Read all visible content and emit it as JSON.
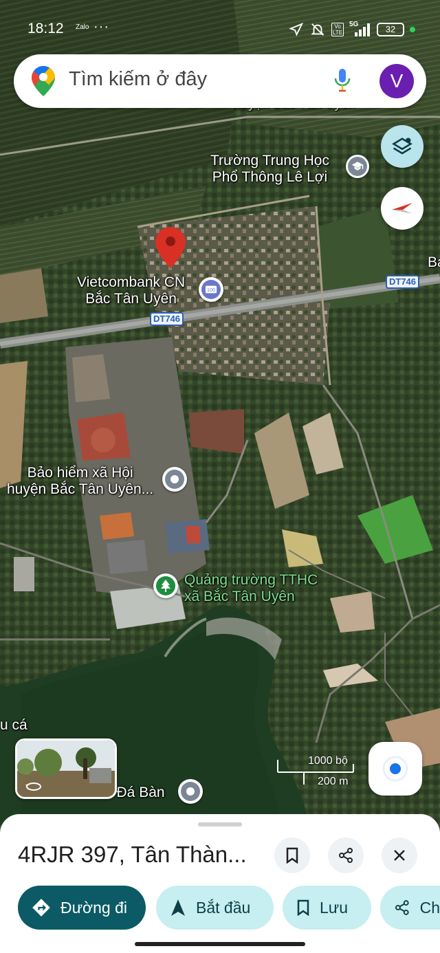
{
  "status_bar": {
    "time": "18:12",
    "notification_app": "Zalo",
    "more": "···",
    "network": "5G",
    "volte": "Vo LTE",
    "battery": "32"
  },
  "search": {
    "placeholder": "Tìm kiếm ở đây",
    "avatar_letter": "V"
  },
  "map": {
    "labels": {
      "school_line1": "Trường Trung Học",
      "school_line2": "Phổ Thông Lê Lợi",
      "bank_line1": "Vietcombank CN",
      "bank_line2": "Bắc Tân Uyên",
      "road_shield_1": "DT746",
      "road_shield_2": "DT746",
      "insurance_line1": "Bảo hiểm xã Hội",
      "insurance_line2": "huyện Bắc Tân Uyên...",
      "square_line1": "Quảng trường TTHC",
      "square_line2": "xã Bắc Tân Uyên",
      "lake_partial": "ồ Đá Bàn",
      "left_edge_partial": "u cá",
      "right_edge_partial": "Ba",
      "top_partial": "huyện Bắc Tân Uyên"
    },
    "scale": {
      "imperial": "1000 bộ",
      "metric": "200 m"
    },
    "colors": {
      "pin": "#d93025",
      "road_shield": "#2b5fb4",
      "park_icon": "#1e8e3e",
      "poi_gray": "#7b8794"
    }
  },
  "place_sheet": {
    "title": "4RJR 397, Tân Thàn...",
    "actions": {
      "directions": "Đường đi",
      "start": "Bắt đầu",
      "save": "Lưu",
      "share": "Ch"
    }
  }
}
